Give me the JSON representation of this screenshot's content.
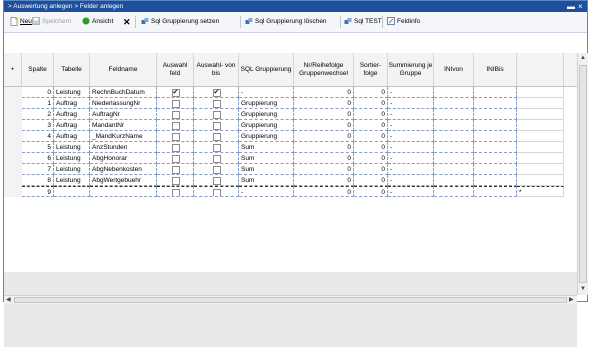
{
  "window": {
    "title": "> Auswertung anlegen > Felder anlegen",
    "minimize_glyph": "▬",
    "close_glyph": "×"
  },
  "toolbar": {
    "new_label": "Neu",
    "save_label": "Speichern",
    "view_label": "Ansicht",
    "delete_glyph": "✕",
    "sql_set_label": "Sql Gruppierung setzen",
    "sql_delete_label": "Sql Gruppierung löschen",
    "sql_test_label": "Sql TEST",
    "fieldinfo_label": "Feldinfo"
  },
  "grid": {
    "row_indicator_header": "•",
    "columns": [
      {
        "key": "spalte",
        "label": "Spalte"
      },
      {
        "key": "tabelle",
        "label": "Tabelle"
      },
      {
        "key": "feldname",
        "label": "Feldname"
      },
      {
        "key": "auswahl",
        "label": "Auswahl feld"
      },
      {
        "key": "auswahl_bis",
        "label": "Auswahl- von bis"
      },
      {
        "key": "sql_gruppierung",
        "label": "SQL Gruppierung"
      },
      {
        "key": "nr_reihefolge",
        "label": "Nr/Reihefolge Gruppenwechsel"
      },
      {
        "key": "sortierfolge",
        "label": "Sortier- folge"
      },
      {
        "key": "summierung",
        "label": "Summierung je Gruppe"
      },
      {
        "key": "inivon",
        "label": "INIvon"
      },
      {
        "key": "inibis",
        "label": "INIBis"
      },
      {
        "key": "extra",
        "label": ""
      }
    ],
    "rows": [
      {
        "spalte": "0",
        "tabelle": "Leistung",
        "feldname": "RechnBuchDatum",
        "auswahl": true,
        "auswahl_bis": true,
        "sql_gruppierung": "-",
        "nr_reihefolge": "0",
        "sortierfolge": "0",
        "summierung": "-",
        "inivon": "",
        "inibis": "",
        "extra": ""
      },
      {
        "spalte": "1",
        "tabelle": "Auftrag",
        "feldname": "NiederlassungNr",
        "auswahl": false,
        "auswahl_bis": false,
        "sql_gruppierung": "Gruppierung",
        "nr_reihefolge": "0",
        "sortierfolge": "0",
        "summierung": "-",
        "inivon": "",
        "inibis": "",
        "extra": ""
      },
      {
        "spalte": "2",
        "tabelle": "Auftrag",
        "feldname": "AuftragNr",
        "auswahl": false,
        "auswahl_bis": false,
        "sql_gruppierung": "Gruppierung",
        "nr_reihefolge": "0",
        "sortierfolge": "0",
        "summierung": "-",
        "inivon": "",
        "inibis": "",
        "extra": ""
      },
      {
        "spalte": "3",
        "tabelle": "Auftrag",
        "feldname": "MandantNr",
        "auswahl": false,
        "auswahl_bis": false,
        "sql_gruppierung": "Gruppierung",
        "nr_reihefolge": "0",
        "sortierfolge": "0",
        "summierung": "-",
        "inivon": "",
        "inibis": "",
        "extra": ""
      },
      {
        "spalte": "4",
        "tabelle": "Auftrag",
        "feldname": "_MandKurzName",
        "auswahl": false,
        "auswahl_bis": false,
        "sql_gruppierung": "Gruppierung",
        "nr_reihefolge": "0",
        "sortierfolge": "0",
        "summierung": "-",
        "inivon": "",
        "inibis": "",
        "extra": ""
      },
      {
        "spalte": "5",
        "tabelle": "Leistung",
        "feldname": "AnzStunden",
        "auswahl": false,
        "auswahl_bis": false,
        "sql_gruppierung": "Sum",
        "nr_reihefolge": "0",
        "sortierfolge": "0",
        "summierung": "-",
        "inivon": "",
        "inibis": "",
        "extra": ""
      },
      {
        "spalte": "6",
        "tabelle": "Leistung",
        "feldname": "AbgHonorar",
        "auswahl": false,
        "auswahl_bis": false,
        "sql_gruppierung": "Sum",
        "nr_reihefolge": "0",
        "sortierfolge": "0",
        "summierung": "-",
        "inivon": "",
        "inibis": "",
        "extra": ""
      },
      {
        "spalte": "7",
        "tabelle": "Leistung",
        "feldname": "AbgNebenkosten",
        "auswahl": false,
        "auswahl_bis": false,
        "sql_gruppierung": "Sum",
        "nr_reihefolge": "0",
        "sortierfolge": "0",
        "summierung": "-",
        "inivon": "",
        "inibis": "",
        "extra": ""
      },
      {
        "spalte": "8",
        "tabelle": "Leistung",
        "feldname": "AbgWertgebuehr",
        "auswahl": false,
        "auswahl_bis": false,
        "sql_gruppierung": "Sum",
        "nr_reihefolge": "0",
        "sortierfolge": "0",
        "summierung": "-",
        "inivon": "",
        "inibis": "",
        "extra": ""
      },
      {
        "spalte": "9",
        "tabelle": "",
        "feldname": "",
        "auswahl": false,
        "auswahl_bis": false,
        "sql_gruppierung": "-",
        "nr_reihefolge": "0",
        "sortierfolge": "0",
        "summierung": "-",
        "inivon": "",
        "inibis": "",
        "extra": "*"
      }
    ]
  },
  "colors": {
    "titlebar": "#1f4f9b",
    "gridline": "#8a9cc8",
    "empty_area": "#e8e8e8",
    "view_icon": "#2e9a2e",
    "sql_icon": "#3a6fb0"
  }
}
